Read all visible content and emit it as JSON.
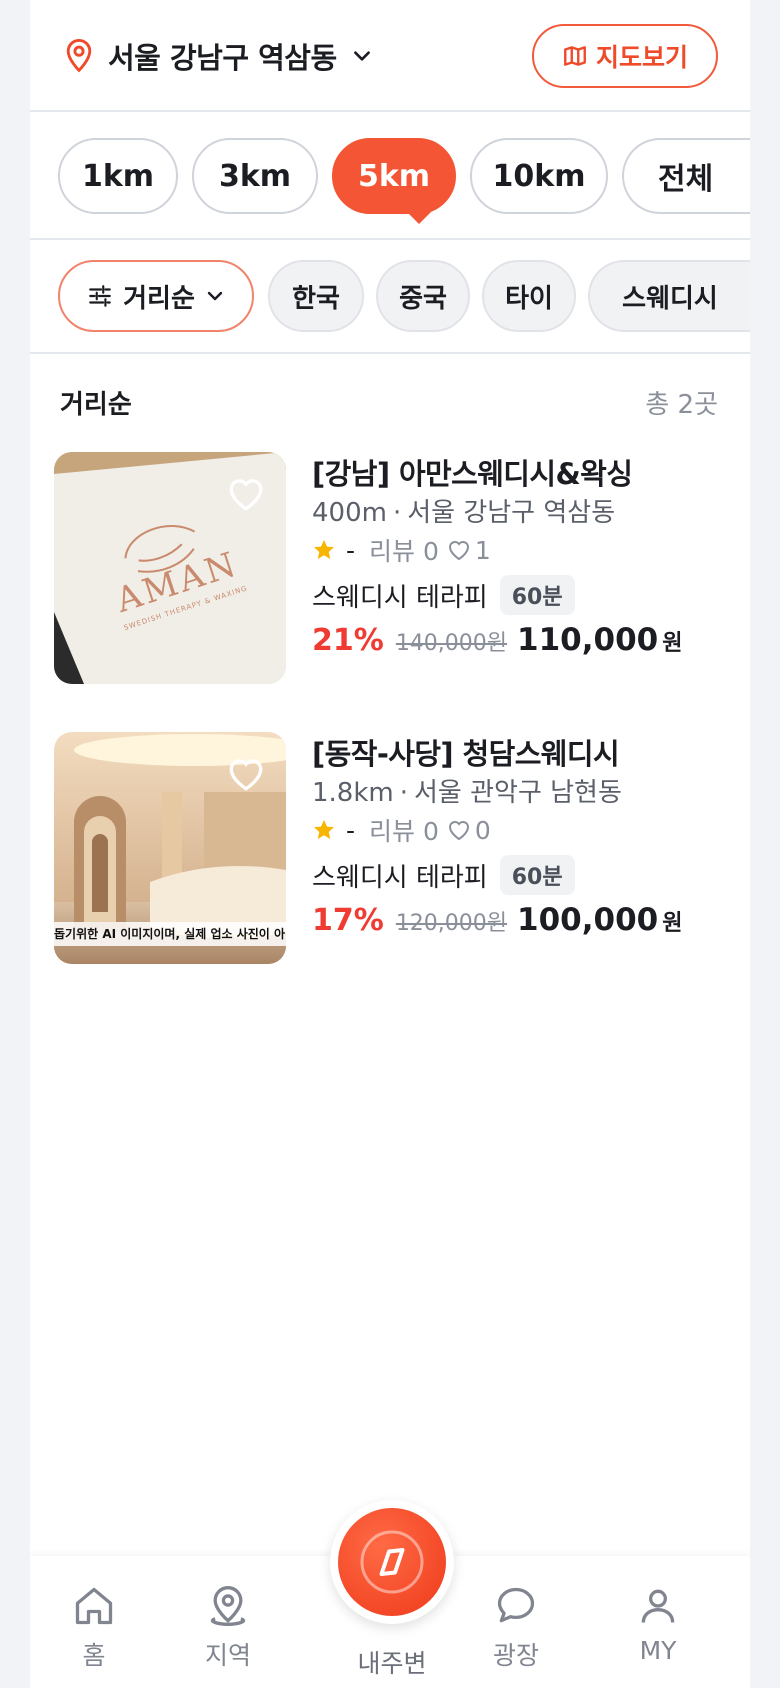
{
  "header": {
    "location": "서울 강남구 역삼동",
    "map_button": "지도보기",
    "location_icon": "map-pin-icon",
    "map_icon": "map-icon"
  },
  "distance_filters": [
    "1km",
    "3km",
    "5km",
    "10km",
    "전체"
  ],
  "selected_distance": "5km",
  "sort": {
    "label": "거리순"
  },
  "categories": [
    "한국",
    "중국",
    "타이",
    "스웨디시"
  ],
  "list": {
    "title": "거리순",
    "count": "총 2곳"
  },
  "shops": [
    {
      "name": "[강남] 아만스웨디시&왁싱",
      "distance": "400m",
      "address": "서울 강남구 역삼동",
      "score": "-",
      "reviews": "리뷰 0",
      "likes": "1",
      "service": "스웨디시 테라피",
      "duration": "60분",
      "discount": "21%",
      "original_price": "140,000원",
      "price": "110,000",
      "won": "원",
      "image_text": "AMAN",
      "image_subtext": "SWEDISH THERAPY & WAXING"
    },
    {
      "name": "[동작-사당] 청담스웨디시",
      "distance": "1.8km",
      "address": "서울 관악구 남현동",
      "score": "-",
      "reviews": "리뷰 0",
      "likes": "0",
      "service": "스웨디시 테라피",
      "duration": "60분",
      "discount": "17%",
      "original_price": "120,000원",
      "price": "100,000",
      "won": "원",
      "image_caption": "돕기위한 AI 이미지이며, 실제 업소 사진이 아"
    }
  ],
  "nav": {
    "home": "홈",
    "region": "지역",
    "nearby": "내주변",
    "plaza": "광장",
    "my": "MY"
  },
  "colors": {
    "accent": "#f35535",
    "discount": "#f03b32",
    "star": "#f7b500"
  }
}
